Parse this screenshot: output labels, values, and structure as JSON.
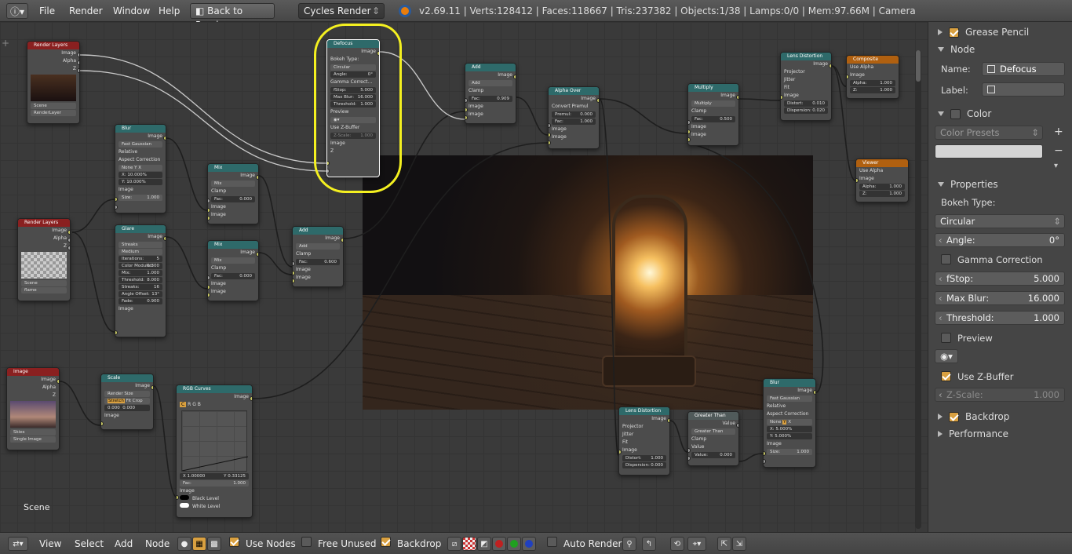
{
  "topbar": {
    "menus": [
      "File",
      "Render",
      "Window",
      "Help"
    ],
    "back_label": "Back to Previous",
    "engine": "Cycles Render",
    "stats": "v2.69.11 | Verts:128412 | Faces:118667 | Tris:237382 | Objects:1/38 | Lamps:0/0 | Mem:97.66M | Camera"
  },
  "editor": {
    "scene_label": "Scene",
    "nodes": {
      "render_layers_1": {
        "title": "Render Layers",
        "outputs": [
          "Image",
          "Alpha",
          "Z"
        ],
        "scene": "Scene",
        "layer": "RenderLayer"
      },
      "render_layers_2": {
        "title": "Render Layers",
        "outputs": [
          "Image",
          "Alpha",
          "Z"
        ],
        "scene": "Scene",
        "layer": "flame"
      },
      "image": {
        "title": "Image",
        "outputs": [
          "Image",
          "Alpha",
          "Z"
        ],
        "img": "Skies",
        "source": "Single Image"
      },
      "blur": {
        "title": "Blur",
        "out": "Image",
        "type": "Fast Gaussian",
        "relative": "Relative",
        "aspect": "Aspect Correction",
        "aspect_opts": [
          "None",
          "Y",
          "X"
        ],
        "x": "X: 10.000%",
        "y": "Y: 10.000%",
        "in": "Image",
        "size": "Size:",
        "size_val": "1.000"
      },
      "glare": {
        "title": "Glare",
        "out": "Image",
        "streaks": "Streaks",
        "medium": "Medium",
        "iterations": "Iterations:",
        "iterations_val": "5",
        "color_mod": "Color Modulati",
        "color_mod_val": "0.300",
        "mix": "Mix:",
        "mix_val": "1.000",
        "threshold": "Threshold:",
        "threshold_val": "8.000",
        "streaks_n": "Streaks:",
        "streaks_val": "16",
        "angle": "Angle Offset:",
        "angle_val": "13°",
        "fade": "Fade:",
        "fade_val": "0.900",
        "in": "Image"
      },
      "mix_1": {
        "title": "Mix",
        "out": "Image",
        "mode": "Mix",
        "clamp": "Clamp",
        "fac": "Fac:",
        "fac_val": "0.000",
        "in1": "Image",
        "in2": "Image"
      },
      "mix_2": {
        "title": "Mix",
        "out": "Image",
        "mode": "Mix",
        "clamp": "Clamp",
        "fac": "Fac:",
        "fac_val": "0.000",
        "in1": "Image",
        "in2": "Image"
      },
      "add_1": {
        "title": "Add",
        "out": "Image",
        "mode": "Add",
        "clamp": "Clamp",
        "fac": "Fac:",
        "fac_val": "0.600",
        "in1": "Image",
        "in2": "Image"
      },
      "scale": {
        "title": "Scale",
        "out": "Image",
        "mode": "Render Size",
        "opts": [
          "Stretch",
          "Fit",
          "Crop"
        ],
        "x": "0.000",
        "y": "0.000",
        "in": "Image"
      },
      "rgb_curves": {
        "title": "RGB Curves",
        "out": "Image",
        "tabs": [
          "C",
          "R",
          "G",
          "B"
        ],
        "x": "X 1.00000",
        "y": "Y 0.33125",
        "fac": "Fac:",
        "fac_val": "1.000",
        "in": "Image",
        "black": "Black Level",
        "white": "White Level"
      },
      "defocus": {
        "title": "Defocus",
        "out": "Image",
        "bokeh": "Bokeh Type:",
        "bokeh_val": "Circular",
        "angle": "Angle:",
        "angle_val": "0°",
        "gamma": "Gamma Correct...",
        "fstop": "fStop:",
        "fstop_val": "5.000",
        "maxblur": "Max Blur:",
        "maxblur_val": "16.000",
        "threshold": "Threshold:",
        "threshold_val": "1.000",
        "preview": "Preview",
        "zbuf": "Use Z-Buffer",
        "zscale": "Z-Scale:",
        "zscale_val": "1.000",
        "in1": "Image",
        "in2": "Z"
      },
      "add_2": {
        "title": "Add",
        "out": "Image",
        "mode": "Add",
        "clamp": "Clamp",
        "fac": "Fac:",
        "fac_val": "0.909",
        "in1": "Image",
        "in2": "Image"
      },
      "alpha_over": {
        "title": "Alpha Over",
        "out": "Image",
        "convert": "Convert Premul",
        "premul": "Premul:",
        "premul_val": "0.000",
        "fac": "Fac:",
        "fac_val": "1.000",
        "in1": "Image",
        "in2": "Image"
      },
      "multiply": {
        "title": "Multiply",
        "out": "Image",
        "mode": "Multiply",
        "clamp": "Clamp",
        "fac": "Fac:",
        "fac_val": "0.500",
        "in1": "Image",
        "in2": "Image"
      },
      "lens_1": {
        "title": "Lens Distortion",
        "out": "Image",
        "projector": "Projector",
        "jitter": "Jitter",
        "fit": "Fit",
        "in": "Image",
        "distort": "Distort:",
        "distort_val": "0.010",
        "dispersion": "Dispersion:",
        "dispersion_val": "0.020"
      },
      "composite": {
        "title": "Composite",
        "use_alpha": "Use Alpha",
        "in": "Image",
        "alpha": "Alpha:",
        "alpha_val": "1.000",
        "z": "Z:",
        "z_val": "1.000"
      },
      "viewer": {
        "title": "Viewer",
        "use_alpha": "Use Alpha",
        "in": "Image",
        "alpha": "Alpha:",
        "alpha_val": "1.000",
        "z": "Z:",
        "z_val": "1.000"
      },
      "lens_2": {
        "title": "Lens Distortion",
        "out": "Image",
        "projector": "Projector",
        "jitter": "Jitter",
        "fit": "Fit",
        "in": "Image",
        "distort": "Distort:",
        "distort_val": "1.000",
        "dispersion": "Dispersion:",
        "dispersion_val": "0.000"
      },
      "greater": {
        "title": "Greater Than",
        "out": "Value",
        "mode": "Greater Than",
        "clamp": "Clamp",
        "in": "Value",
        "value": "Value:",
        "value_val": "0.000"
      },
      "blur_2": {
        "title": "Blur",
        "out": "Image",
        "type": "Fast Gaussian",
        "relative": "Relative",
        "aspect": "Aspect Correction",
        "aspect_opts": [
          "None",
          "Y",
          "X"
        ],
        "x": "X: 5.000%",
        "y": "Y: 5.000%",
        "in": "Image",
        "size": "Size:",
        "size_val": "1.000"
      }
    }
  },
  "props": {
    "grease_pencil": "Grease Pencil",
    "node_section": "Node",
    "name_label": "Name:",
    "name_value": "Defocus",
    "label_label": "Label:",
    "color_section": "Color",
    "color_presets": "Color Presets",
    "properties_section": "Properties",
    "bokeh_label": "Bokeh Type:",
    "bokeh_value": "Circular",
    "angle_label": "Angle:",
    "angle_value": "0°",
    "gamma_label": "Gamma Correction",
    "fstop_label": "fStop:",
    "fstop_value": "5.000",
    "maxblur_label": "Max Blur:",
    "maxblur_value": "16.000",
    "threshold_label": "Threshold:",
    "threshold_value": "1.000",
    "preview_label": "Preview",
    "zbuffer_label": "Use Z-Buffer",
    "zscale_label": "Z-Scale:",
    "zscale_value": "1.000",
    "backdrop_section": "Backdrop",
    "performance_section": "Performance"
  },
  "bottombar": {
    "view": "View",
    "select": "Select",
    "add": "Add",
    "node": "Node",
    "use_nodes": "Use Nodes",
    "free_unused": "Free Unused",
    "backdrop": "Backdrop",
    "auto_render": "Auto Render"
  }
}
